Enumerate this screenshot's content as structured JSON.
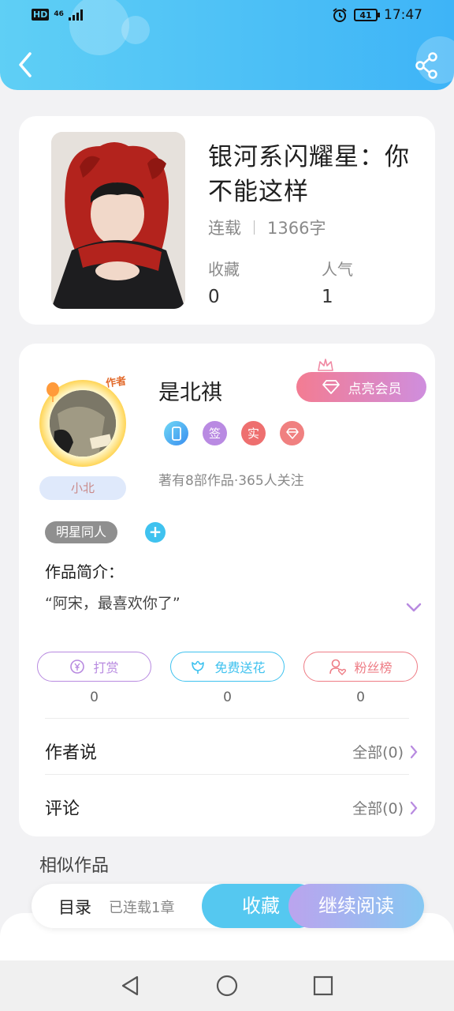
{
  "status_bar": {
    "hd": "HD",
    "network": "46",
    "battery": "41",
    "time": "17:47"
  },
  "book": {
    "title": "银河系闪耀星：你不能这样",
    "status": "连载",
    "word_count": "1366字",
    "favorites_label": "收藏",
    "favorites_value": "0",
    "popularity_label": "人气",
    "popularity_value": "1"
  },
  "author": {
    "tag": "作者",
    "nickname": "小北",
    "name": "是北祺",
    "vip_button": "点亮会员",
    "badges": [
      "签",
      "实"
    ],
    "stats": "著有8部作品·365人关注"
  },
  "genre_tag": "明星同人",
  "add_tag": "+",
  "intro": {
    "title": "作品简介：",
    "text": "“阿宋，最喜欢你了”"
  },
  "actions": [
    {
      "label": "打赏",
      "count": "0",
      "color": "#b88ae0"
    },
    {
      "label": "免费送花",
      "count": "0",
      "color": "#3fc2ef"
    },
    {
      "label": "粉丝榜",
      "count": "0",
      "color": "#ee7d86"
    }
  ],
  "rows": {
    "author_says_label": "作者说",
    "author_says_value": "全部(0)",
    "comments_label": "评论",
    "comments_value": "全部(0)"
  },
  "similar_title": "相似作品",
  "bottom_bar": {
    "toc_label": "目录",
    "toc_status": "已连载1章",
    "favorite_button": "收藏",
    "continue_button": "继续阅读"
  },
  "colors": {
    "header": "#3eb4f7",
    "accent_purple": "#b88ae0",
    "accent_blue": "#3fc2ef",
    "accent_pink": "#ee7d86"
  }
}
